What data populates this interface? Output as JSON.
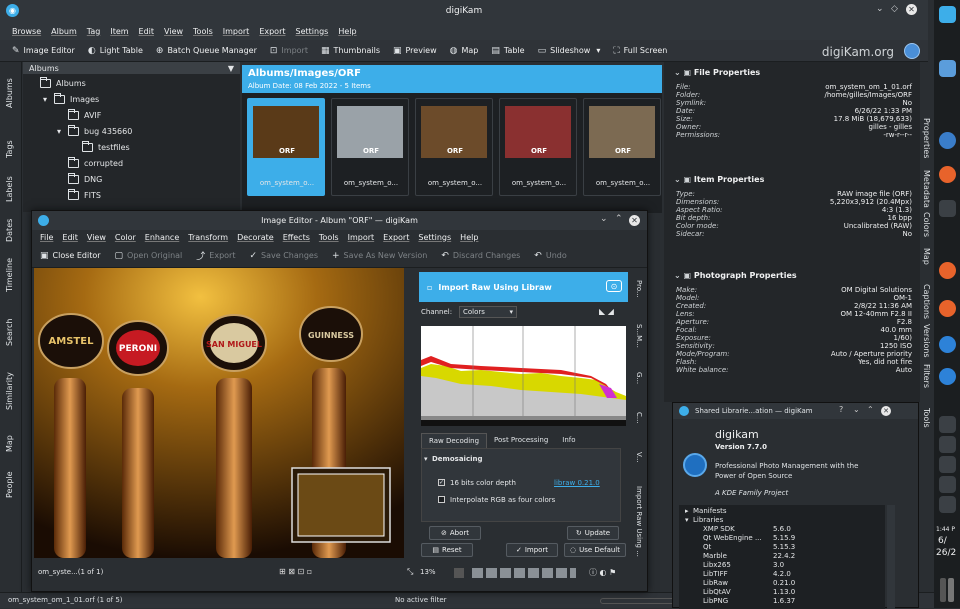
{
  "window": {
    "title": "digiKam",
    "app_icon": "digikam-icon",
    "brand": "digiKam.org"
  },
  "menu": [
    "Browse",
    "Album",
    "Tag",
    "Item",
    "Edit",
    "View",
    "Tools",
    "Import",
    "Export",
    "Settings",
    "Help"
  ],
  "toolbar": [
    {
      "label": "Image Editor",
      "icon": "pencil-icon",
      "enabled": true
    },
    {
      "label": "Light Table",
      "icon": "lighttable-icon",
      "enabled": true
    },
    {
      "label": "Batch Queue Manager",
      "icon": "batch-icon",
      "enabled": true
    },
    {
      "label": "Import",
      "icon": "import-icon",
      "enabled": false
    },
    {
      "label": "Thumbnails",
      "icon": "thumbnails-icon",
      "enabled": true
    },
    {
      "label": "Preview",
      "icon": "preview-icon",
      "enabled": true
    },
    {
      "label": "Map",
      "icon": "globe-icon",
      "enabled": true
    },
    {
      "label": "Table",
      "icon": "table-icon",
      "enabled": true
    },
    {
      "label": "Slideshow",
      "icon": "slideshow-icon",
      "enabled": true
    },
    {
      "label": "Full Screen",
      "icon": "fullscreen-icon",
      "enabled": true
    }
  ],
  "left_tabs": [
    "Albums",
    "Tags",
    "Labels",
    "Dates",
    "Timeline",
    "Search",
    "Similarity",
    "Map",
    "People"
  ],
  "albums": {
    "header": "Albums",
    "nodes": [
      {
        "label": "Albums",
        "depth": 0,
        "expander": ""
      },
      {
        "label": "Images",
        "depth": 1,
        "expander": "▾"
      },
      {
        "label": "AVIF",
        "depth": 2,
        "expander": ""
      },
      {
        "label": "bug 435660",
        "depth": 2,
        "expander": "▾"
      },
      {
        "label": "testfiles",
        "depth": 3,
        "expander": ""
      },
      {
        "label": "corrupted",
        "depth": 2,
        "expander": ""
      },
      {
        "label": "DNG",
        "depth": 2,
        "expander": ""
      },
      {
        "label": "FITS",
        "depth": 2,
        "expander": ""
      }
    ]
  },
  "album_view": {
    "title": "Albums/Images/ORF",
    "subtitle": "Album Date: 08 Feb 2022 - 5 Items",
    "thumbs": [
      {
        "caption": "om_system_o...",
        "badge": "ORF",
        "selected": true,
        "bg": "#5a3a18"
      },
      {
        "caption": "om_system_o...",
        "badge": "ORF",
        "selected": false,
        "bg": "#9aa2a8"
      },
      {
        "caption": "om_system_o...",
        "badge": "ORF",
        "selected": false,
        "bg": "#6c4b2a"
      },
      {
        "caption": "om_system_o...",
        "badge": "ORF",
        "selected": false,
        "bg": "#8a3030"
      },
      {
        "caption": "om_system_o...",
        "badge": "ORF",
        "selected": false,
        "bg": "#7c6a52"
      }
    ]
  },
  "file_props": {
    "title": "File Properties",
    "rows": [
      [
        "File:",
        "om_system_om_1_01.orf"
      ],
      [
        "Folder:",
        "/home/gilles/Images/ORF"
      ],
      [
        "Symlink:",
        "No"
      ],
      [
        "Date:",
        "6/26/22 1:33 PM"
      ],
      [
        "Size:",
        "17.8 MiB (18,679,633)"
      ],
      [
        "Owner:",
        "gilles - gilles"
      ],
      [
        "Permissions:",
        "-rw-r--r--"
      ]
    ]
  },
  "item_props": {
    "title": "Item Properties",
    "rows": [
      [
        "Type:",
        "RAW image file (ORF)"
      ],
      [
        "Dimensions:",
        "5,220x3,912 (20.4Mpx)"
      ],
      [
        "Aspect Ratio:",
        "4:3 (1.3)"
      ],
      [
        "Bit depth:",
        "16 bpp"
      ],
      [
        "Color mode:",
        "Uncalibrated (RAW)"
      ],
      [
        "Sidecar:",
        "No"
      ]
    ]
  },
  "photo_props": {
    "title": "Photograph Properties",
    "rows": [
      [
        "Make:",
        "OM Digital Solutions"
      ],
      [
        "Model:",
        "OM-1"
      ],
      [
        "Created:",
        "2/8/22 11:36 AM"
      ],
      [
        "Lens:",
        "OM 12-40mm F2.8 II"
      ],
      [
        "Aperture:",
        "F2.8"
      ],
      [
        "Focal:",
        "40.0 mm"
      ],
      [
        "Exposure:",
        "1/60)"
      ],
      [
        "Sensitivity:",
        "1250 ISO"
      ],
      [
        "Mode/Program:",
        "Auto / Aperture priority"
      ],
      [
        "Flash:",
        "Yes, did not fire"
      ],
      [
        "White balance:",
        "Auto"
      ]
    ]
  },
  "right_tabs": [
    "Properties",
    "Metadata",
    "Colors",
    "Map",
    "Captions",
    "Versions",
    "Filters",
    "Tools"
  ],
  "statusbar": {
    "left": "om_system_om_1_01.orf (1 of 5)",
    "center": "No active filter"
  },
  "editor": {
    "title": "Image Editor - Album \"ORF\" — digiKam",
    "menu": [
      "File",
      "Edit",
      "View",
      "Color",
      "Enhance",
      "Transform",
      "Decorate",
      "Effects",
      "Tools",
      "Import",
      "Export",
      "Settings",
      "Help"
    ],
    "toolbar": [
      {
        "label": "Close Editor",
        "enabled": true
      },
      {
        "label": "Open Original",
        "enabled": false
      },
      {
        "label": "Export",
        "enabled": false
      },
      {
        "label": "Save Changes",
        "enabled": false
      },
      {
        "label": "Save As New Version",
        "enabled": false
      },
      {
        "label": "Discard Changes",
        "enabled": false
      },
      {
        "label": "Undo",
        "enabled": false
      }
    ],
    "photo_labels": [
      "AMSTEL",
      "PERONI",
      "SAN MIGUEL",
      "GUINNESS"
    ],
    "status_left": "om_syste...(1 of 1)",
    "zoom": "13%",
    "raw": {
      "title": "Import Raw Using Libraw",
      "channel_label": "Channel:",
      "channel_value": "Colors",
      "tabs": [
        "Raw Decoding",
        "Post Processing",
        "Info"
      ],
      "section": "Demosaicing",
      "opt1": "16 bits color depth",
      "opt1_checked": true,
      "link": "libraw 0.21.0",
      "opt2": "Interpolate RGB as four colors",
      "opt2_checked": false,
      "abort": "Abort",
      "update": "Update",
      "reset": "Reset",
      "import": "Import",
      "use_default": "Use Default"
    },
    "side_tabs": [
      "Pro...",
      "S...M...",
      "G...",
      "C...",
      "V...",
      "Import Raw Using ..."
    ]
  },
  "libs": {
    "title": "Shared Librarie...ation — digiKam",
    "name": "digikam",
    "version": "Version 7.7.0",
    "desc1": "Professional Photo Management with the",
    "desc2": "Power of Open Source",
    "kde": "A KDE Family Project",
    "tree": [
      [
        "Manifests",
        ""
      ],
      [
        "Libraries",
        ""
      ],
      [
        "XMP SDK",
        "5.6.0"
      ],
      [
        "Qt WebEngine ...",
        "5.15.9"
      ],
      [
        "Qt",
        "5.15.3"
      ],
      [
        "Marble",
        "22.4.2"
      ],
      [
        "Libx265",
        "3.0"
      ],
      [
        "LibTIFF",
        "4.2.0"
      ],
      [
        "LibRaw",
        "0.21.0"
      ],
      [
        "LibQtAV",
        "1.13.0"
      ],
      [
        "LibPNG",
        "1.6.37"
      ]
    ]
  },
  "clock": {
    "time": "1:44 P",
    "date1": "6/",
    "date2": "26/2"
  }
}
